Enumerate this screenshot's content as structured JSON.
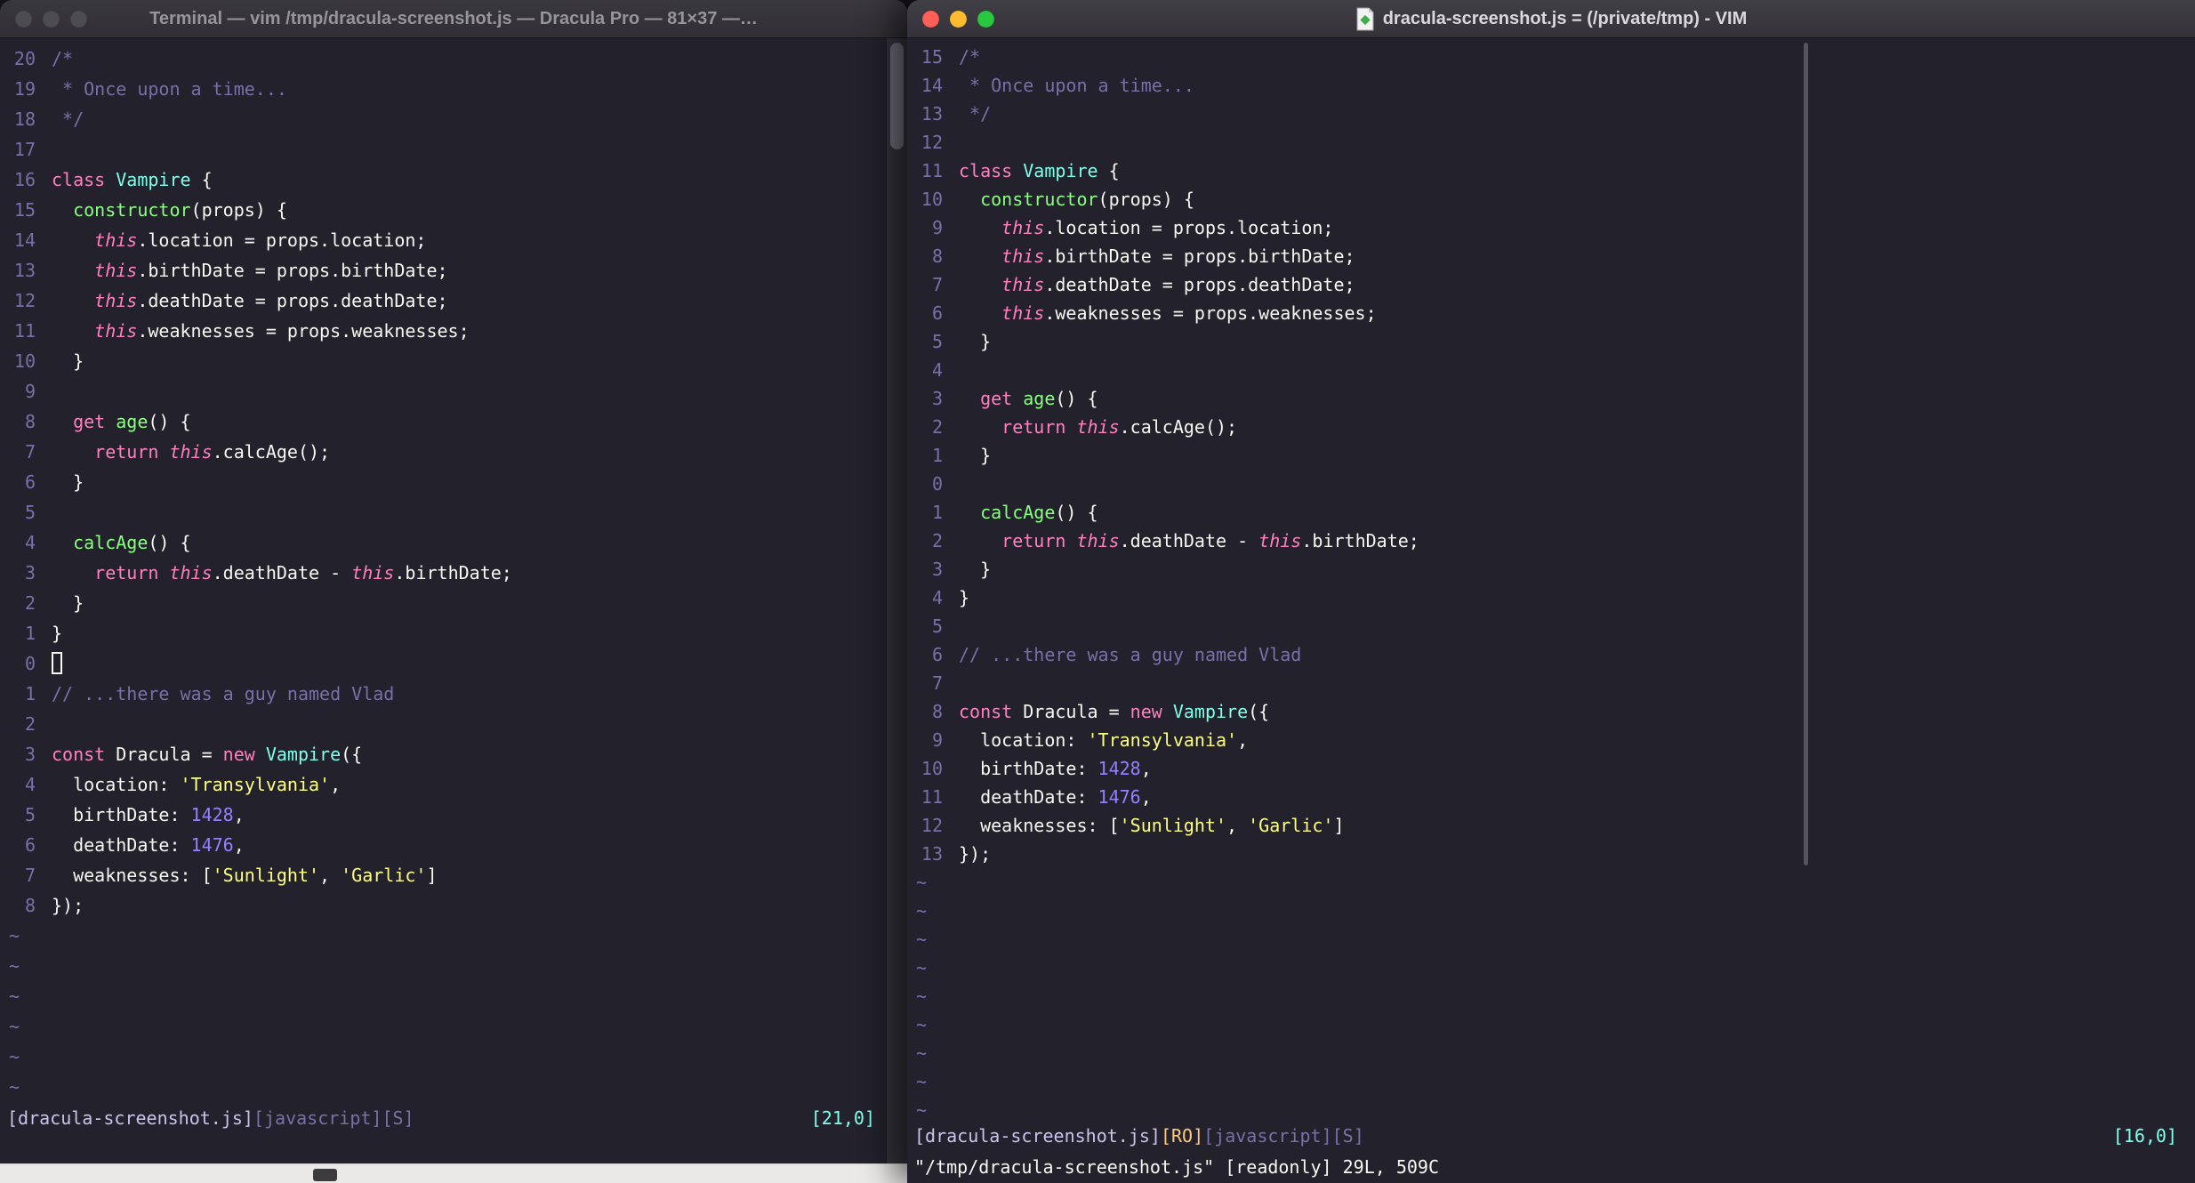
{
  "palette": {
    "bg": "#22212C",
    "fg": "#F8F8F2",
    "comment": "#7970A9",
    "pink": "#FF80BF",
    "cyan": "#80FFEA",
    "green": "#8AFF80",
    "purple": "#9580FF",
    "yellow": "#FFFF80",
    "orange": "#FFCA80",
    "line_number": "#7970A9",
    "status_file": "#CBC3EE",
    "status_position": "#80FFEA",
    "traffic_red": "#FF5F57",
    "traffic_yellow": "#FEBC2E",
    "traffic_green": "#28C840",
    "traffic_inactive": "#4D4C53"
  },
  "left_window": {
    "title": "Terminal — vim /tmp/dracula-screenshot.js — Dracula Pro — 81×37 —…",
    "focused": false,
    "cursor_line_index": 20,
    "cursor_style": "hollow",
    "tilde_count": 6,
    "relative_numbers": [
      "20",
      "19",
      "18",
      "17",
      "16",
      "15",
      "14",
      "13",
      "12",
      "11",
      "10",
      "9",
      "8",
      "7",
      "6",
      "5",
      "4",
      "3",
      "2",
      "1",
      "0",
      "1",
      "2",
      "3",
      "4",
      "5",
      "6",
      "7",
      "8"
    ],
    "statusline": {
      "file": "[dracula-screenshot.js]",
      "meta": "[javascript][S]",
      "position": "[21,0]"
    }
  },
  "right_window": {
    "title": "dracula-screenshot.js = (/private/tmp) - VIM",
    "focused": true,
    "cursor_line_index": 15,
    "cursor_style": "none",
    "tilde_count": 9,
    "relative_numbers": [
      "15",
      "14",
      "13",
      "12",
      "11",
      "10",
      "9",
      "8",
      "7",
      "6",
      "5",
      "4",
      "3",
      "2",
      "1",
      "0",
      "1",
      "2",
      "3",
      "4",
      "5",
      "6",
      "7",
      "8",
      "9",
      "10",
      "11",
      "12",
      "13"
    ],
    "statusline": {
      "file": "[dracula-screenshot.js]",
      "readonly": "[RO]",
      "meta": "[javascript][S]",
      "position": "[16,0]"
    },
    "message_line": "\"/tmp/dracula-screenshot.js\" [readonly] 29L, 509C"
  },
  "tilde": "~",
  "code_lines": [
    [
      [
        "c",
        "/*"
      ]
    ],
    [
      [
        "c",
        " * Once upon a time..."
      ]
    ],
    [
      [
        "c",
        " */"
      ]
    ],
    [],
    [
      [
        "p",
        "class"
      ],
      [
        "f",
        " "
      ],
      [
        "cy",
        "Vampire"
      ],
      [
        "f",
        " {"
      ]
    ],
    [
      [
        "f",
        "  "
      ],
      [
        "g",
        "constructor"
      ],
      [
        "f",
        "(props) {"
      ]
    ],
    [
      [
        "f",
        "    "
      ],
      [
        "pi",
        "this"
      ],
      [
        "f",
        ".location = props.location;"
      ]
    ],
    [
      [
        "f",
        "    "
      ],
      [
        "pi",
        "this"
      ],
      [
        "f",
        ".birthDate = props.birthDate;"
      ]
    ],
    [
      [
        "f",
        "    "
      ],
      [
        "pi",
        "this"
      ],
      [
        "f",
        ".deathDate = props.deathDate;"
      ]
    ],
    [
      [
        "f",
        "    "
      ],
      [
        "pi",
        "this"
      ],
      [
        "f",
        ".weaknesses = props.weaknesses;"
      ]
    ],
    [
      [
        "f",
        "  }"
      ]
    ],
    [],
    [
      [
        "f",
        "  "
      ],
      [
        "p",
        "get"
      ],
      [
        "f",
        " "
      ],
      [
        "g",
        "age"
      ],
      [
        "f",
        "() {"
      ]
    ],
    [
      [
        "f",
        "    "
      ],
      [
        "p",
        "return"
      ],
      [
        "f",
        " "
      ],
      [
        "pi",
        "this"
      ],
      [
        "f",
        ".calcAge();"
      ]
    ],
    [
      [
        "f",
        "  }"
      ]
    ],
    [],
    [
      [
        "f",
        "  "
      ],
      [
        "g",
        "calcAge"
      ],
      [
        "f",
        "() {"
      ]
    ],
    [
      [
        "f",
        "    "
      ],
      [
        "p",
        "return"
      ],
      [
        "f",
        " "
      ],
      [
        "pi",
        "this"
      ],
      [
        "f",
        ".deathDate - "
      ],
      [
        "pi",
        "this"
      ],
      [
        "f",
        ".birthDate;"
      ]
    ],
    [
      [
        "f",
        "  }"
      ]
    ],
    [
      [
        "f",
        "}"
      ]
    ],
    [],
    [
      [
        "c",
        "// ...there was a guy named Vlad"
      ]
    ],
    [],
    [
      [
        "p",
        "const"
      ],
      [
        "f",
        " Dracula = "
      ],
      [
        "p",
        "new"
      ],
      [
        "f",
        " "
      ],
      [
        "cy",
        "Vampire"
      ],
      [
        "f",
        "({"
      ]
    ],
    [
      [
        "f",
        "  location: "
      ],
      [
        "y",
        "'Transylvania'"
      ],
      [
        "f",
        ","
      ]
    ],
    [
      [
        "f",
        "  birthDate: "
      ],
      [
        "pu",
        "1428"
      ],
      [
        "f",
        ","
      ]
    ],
    [
      [
        "f",
        "  deathDate: "
      ],
      [
        "pu",
        "1476"
      ],
      [
        "f",
        ","
      ]
    ],
    [
      [
        "f",
        "  weaknesses: ["
      ],
      [
        "y",
        "'Sunlight'"
      ],
      [
        "f",
        ", "
      ],
      [
        "y",
        "'Garlic'"
      ],
      [
        "f",
        "]"
      ]
    ],
    [
      [
        "f",
        "});"
      ]
    ]
  ]
}
